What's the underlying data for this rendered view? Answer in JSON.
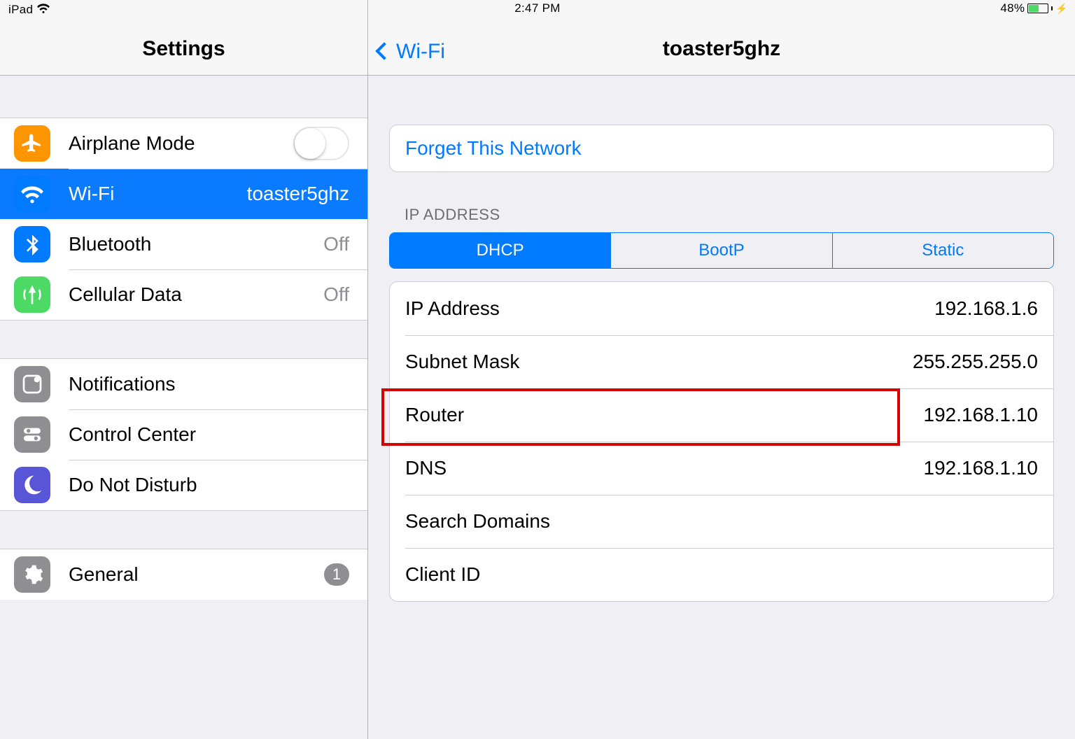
{
  "status": {
    "device": "iPad",
    "time": "2:47 PM",
    "battery_pct": "48%"
  },
  "sidebar": {
    "title": "Settings",
    "items": [
      {
        "label": "Airplane Mode",
        "value": ""
      },
      {
        "label": "Wi-Fi",
        "value": "toaster5ghz"
      },
      {
        "label": "Bluetooth",
        "value": "Off"
      },
      {
        "label": "Cellular Data",
        "value": "Off"
      },
      {
        "label": "Notifications",
        "value": ""
      },
      {
        "label": "Control Center",
        "value": ""
      },
      {
        "label": "Do Not Disturb",
        "value": ""
      },
      {
        "label": "General",
        "value": "1"
      }
    ]
  },
  "detail": {
    "back": "Wi-Fi",
    "title": "toaster5ghz",
    "forget": "Forget This Network",
    "section_ip": "IP ADDRESS",
    "segments": [
      "DHCP",
      "BootP",
      "Static"
    ],
    "rows": [
      {
        "label": "IP Address",
        "value": "192.168.1.6"
      },
      {
        "label": "Subnet Mask",
        "value": "255.255.255.0"
      },
      {
        "label": "Router",
        "value": "192.168.1.10"
      },
      {
        "label": "DNS",
        "value": "192.168.1.10"
      },
      {
        "label": "Search Domains",
        "value": ""
      },
      {
        "label": "Client ID",
        "value": ""
      }
    ]
  },
  "colors": {
    "accent": "#007aff",
    "highlight": "#d40202"
  }
}
